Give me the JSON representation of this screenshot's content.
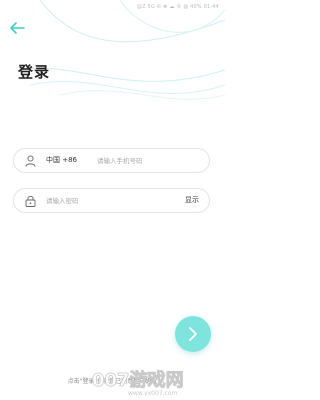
{
  "status_bar": {
    "text": "@Z  5G ✉ ❖ ☁ 令 ▥ 40% 01:44"
  },
  "header": {
    "back_icon": "arrow-left-icon",
    "title": "登录"
  },
  "phone_field": {
    "icon": "user-icon",
    "country_code": "中国 +86",
    "placeholder": "请输入手机号码",
    "value": ""
  },
  "password_field": {
    "icon": "lock-icon",
    "placeholder": "请输入密码",
    "value": "",
    "toggle_label": "显示"
  },
  "next_button": {
    "icon": "chevron-right-icon",
    "color": "#7fe3de"
  },
  "agreement": {
    "prefix": "点击\"登录\"代表你已同意",
    "link": "用户协议"
  },
  "watermark": {
    "text": "007游戏网",
    "url": "www.yx007.com"
  },
  "colors": {
    "accent": "#3ccfc6",
    "wave": "#bfeeed"
  }
}
